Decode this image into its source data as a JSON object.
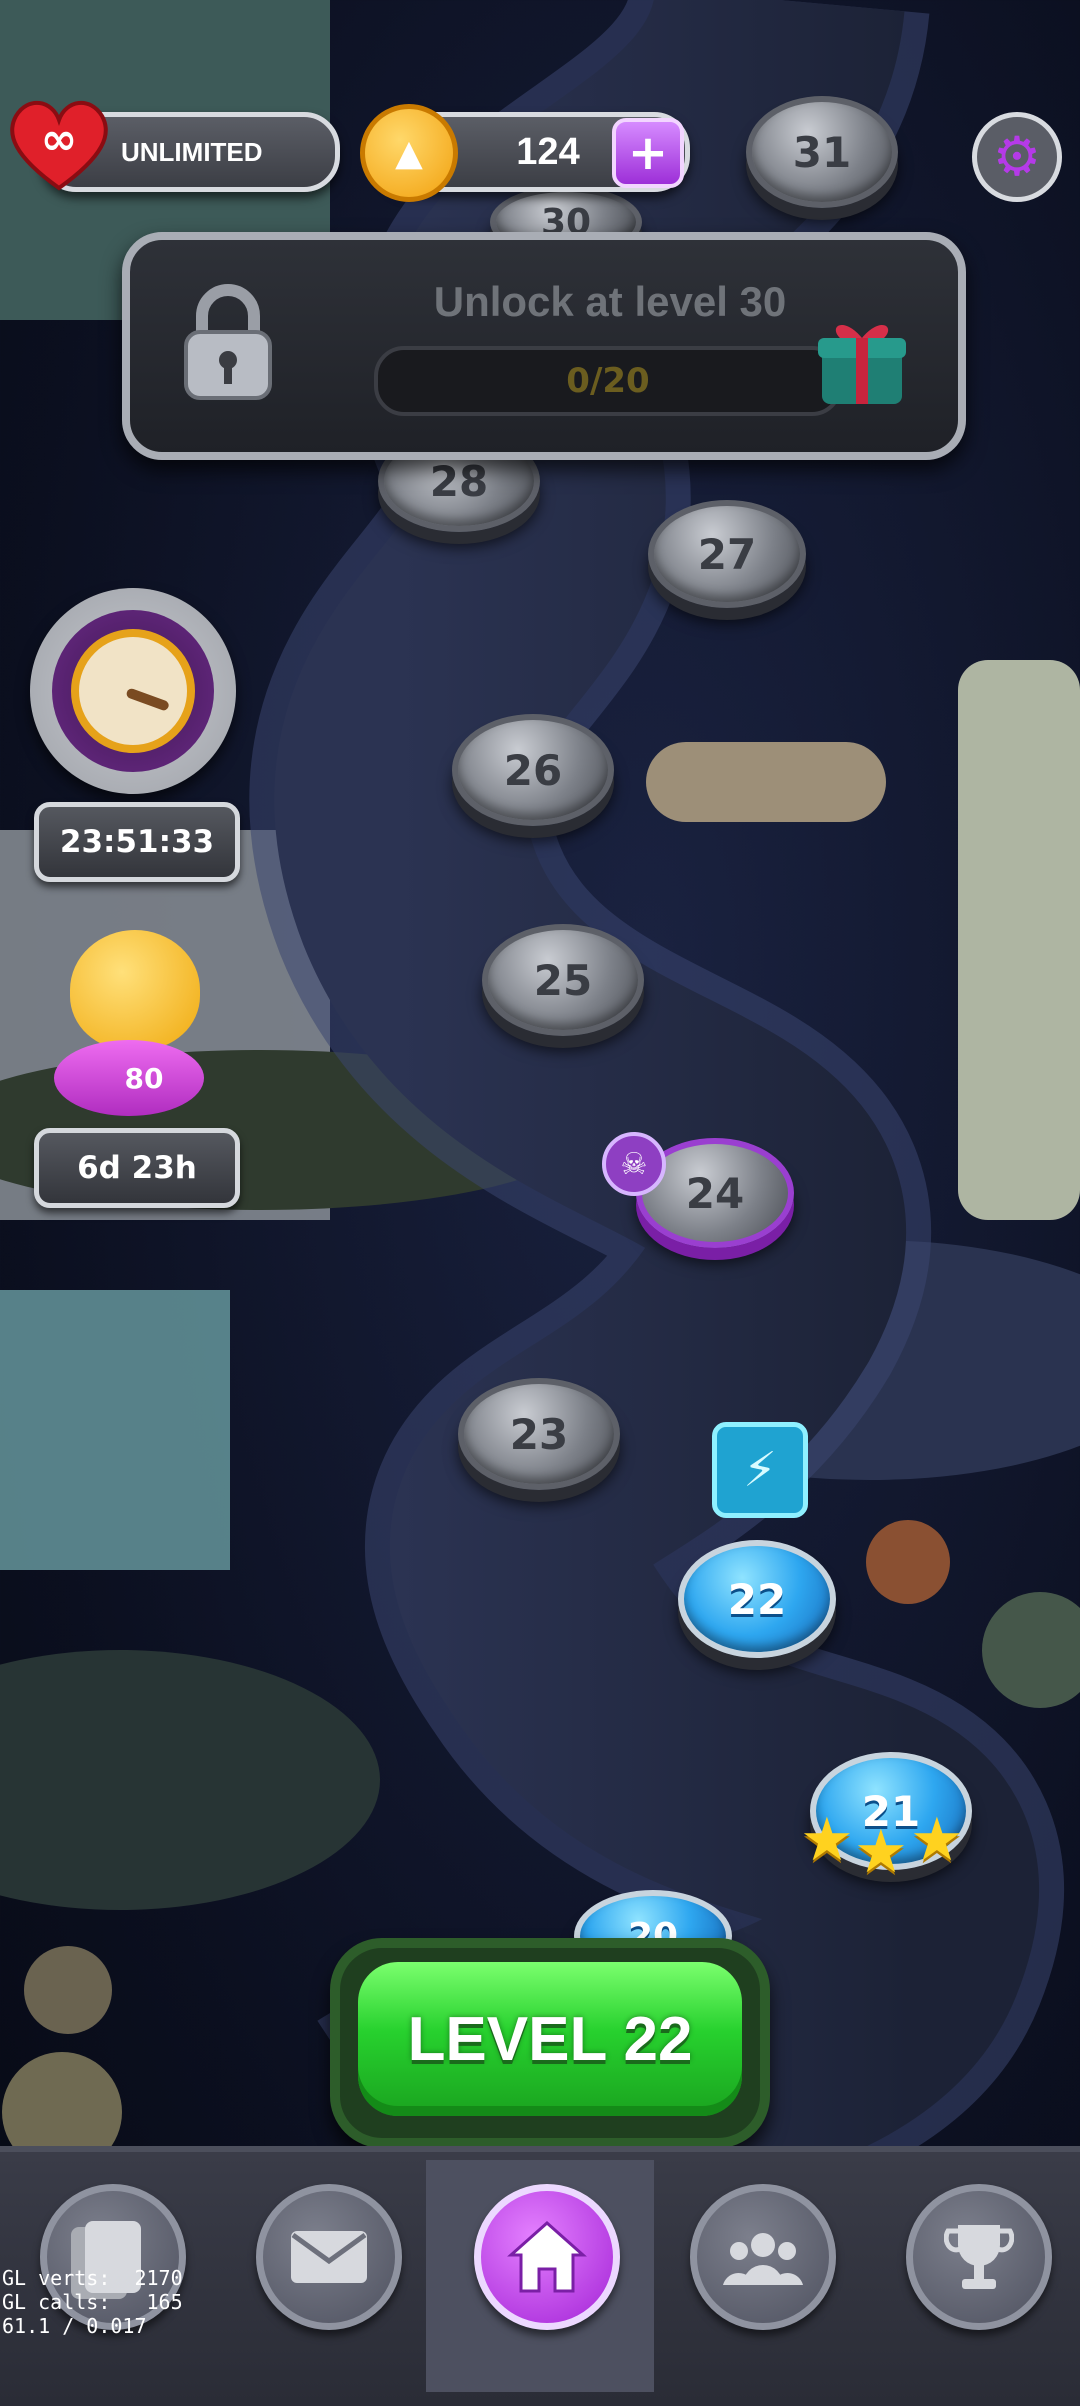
{
  "top_bar": {
    "lives_label": "UNLIMITED",
    "coins": "124",
    "add_icon": "plus-icon",
    "settings_icon": "gear-icon"
  },
  "lock_panel": {
    "title": "Unlock at level 30",
    "progress_text": "0/20",
    "progress": 0,
    "icons": [
      "lock-icon",
      "gift-icon"
    ]
  },
  "map": {
    "levels": [
      {
        "number": "31",
        "state": "locked"
      },
      {
        "number": "30",
        "state": "locked"
      },
      {
        "number": "28",
        "state": "locked"
      },
      {
        "number": "27",
        "state": "locked"
      },
      {
        "number": "26",
        "state": "locked"
      },
      {
        "number": "25",
        "state": "locked"
      },
      {
        "number": "24",
        "state": "locked-hard"
      },
      {
        "number": "23",
        "state": "locked"
      },
      {
        "number": "22",
        "state": "current"
      },
      {
        "number": "21",
        "state": "completed",
        "stars": 3
      },
      {
        "number": "20",
        "state": "completed"
      }
    ],
    "booster_icon": "lightning-icon",
    "hard_icon": "skull-icon"
  },
  "side": {
    "event_timer": "23:51:33",
    "piggy_coins": "80",
    "piggy_timer": "6d 23h"
  },
  "play_button": {
    "label": "LEVEL 22"
  },
  "bottom_nav": [
    {
      "icon": "cards-icon"
    },
    {
      "icon": "mail-icon"
    },
    {
      "icon": "home-icon",
      "active": true
    },
    {
      "icon": "friends-icon"
    },
    {
      "icon": "trophy-icon"
    }
  ],
  "debug": {
    "line1": "GL verts:  2170",
    "line2": "GL calls:   165",
    "line3": "61.1 / 0.017"
  },
  "colors": {
    "accent_purple": "#a323d6",
    "play_green": "#27d12e",
    "current_blue": "#2ea7f0",
    "star_gold": "#ffd21f"
  }
}
